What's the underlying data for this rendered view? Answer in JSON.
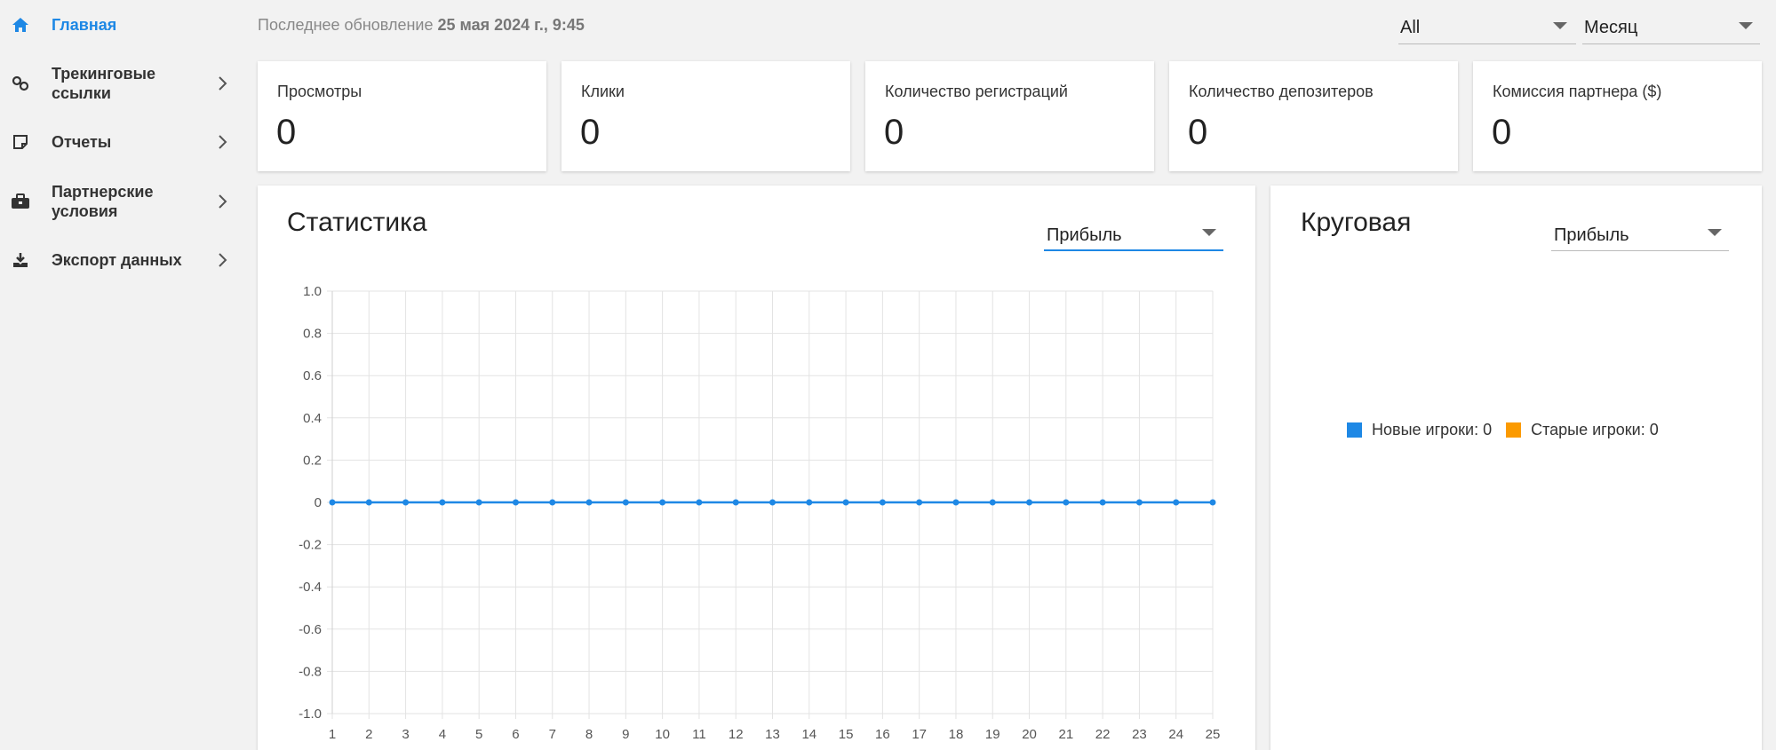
{
  "sidebar": {
    "items": [
      {
        "label": "Главная",
        "icon": "home-icon",
        "active": true
      },
      {
        "label": "Трекинговые\nссылки",
        "icon": "link-icon"
      },
      {
        "label": "Отчеты",
        "icon": "note-icon"
      },
      {
        "label": "Партнерские\nусловия",
        "icon": "briefcase-icon"
      },
      {
        "label": "Экспорт данных",
        "icon": "download-icon"
      }
    ]
  },
  "header": {
    "last_update_prefix": "Последнее обновление",
    "last_update_value": "25 мая 2024 г., 9:45",
    "filter_select": "All",
    "period_select": "Месяц"
  },
  "cards": [
    {
      "label": "Просмотры",
      "value": "0"
    },
    {
      "label": "Клики",
      "value": "0"
    },
    {
      "label": "Количество регистраций",
      "value": "0"
    },
    {
      "label": "Количество депозитеров",
      "value": "0"
    },
    {
      "label": "Комиссия партнера ($)",
      "value": "0"
    }
  ],
  "stats_panel": {
    "title": "Статистика",
    "metric_select": "Прибыль"
  },
  "pie_panel": {
    "title": "Круговая",
    "metric_select": "Прибыль",
    "legend": [
      {
        "label": "Новые игроки: 0",
        "color": "#1e88e5"
      },
      {
        "label": "Старые игроки: 0",
        "color": "#fb9a00"
      }
    ]
  },
  "colors": {
    "accent": "#1e88e5",
    "orange": "#fb9a00"
  },
  "chart_data": {
    "type": "line",
    "x": [
      1,
      2,
      3,
      4,
      5,
      6,
      7,
      8,
      9,
      10,
      11,
      12,
      13,
      14,
      15,
      16,
      17,
      18,
      19,
      20,
      21,
      22,
      23,
      24,
      25
    ],
    "series": [
      {
        "values": [
          0,
          0,
          0,
          0,
          0,
          0,
          0,
          0,
          0,
          0,
          0,
          0,
          0,
          0,
          0,
          0,
          0,
          0,
          0,
          0,
          0,
          0,
          0,
          0,
          0
        ]
      }
    ],
    "y_ticks": [
      "1.0",
      "0.8",
      "0.6",
      "0.4",
      "0.2",
      "0",
      "-0.2",
      "-0.4",
      "-0.6",
      "-0.8",
      "-1.0"
    ],
    "ylim": [
      -1,
      1
    ],
    "grid": true
  }
}
